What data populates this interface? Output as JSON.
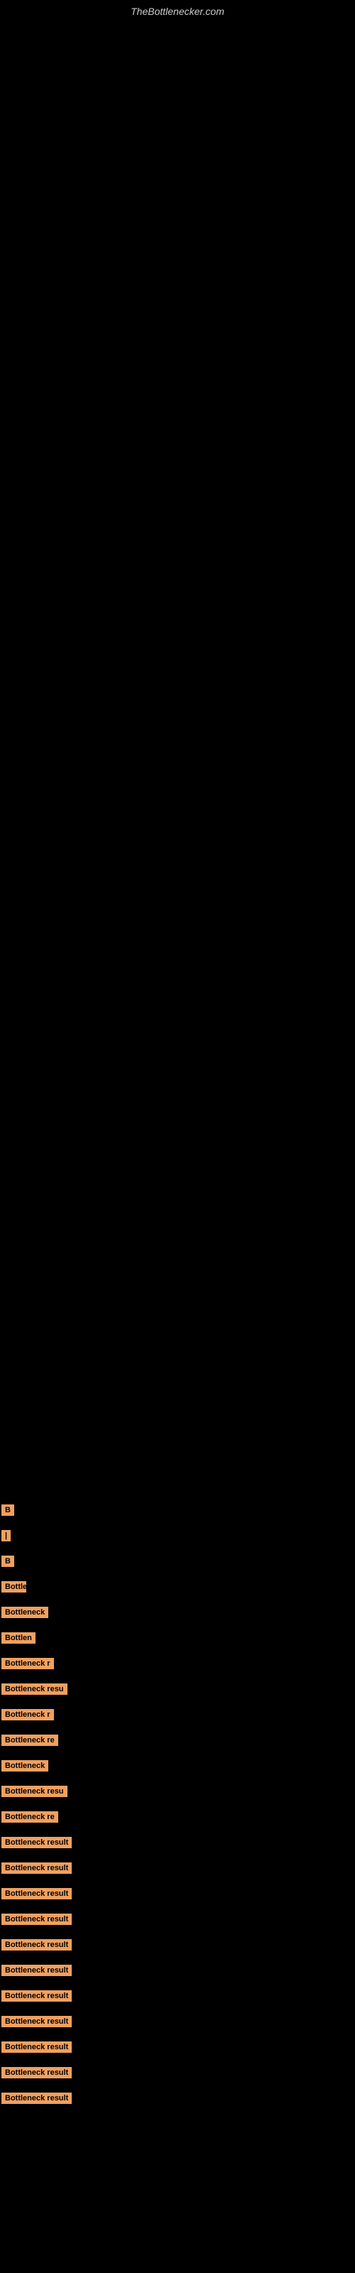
{
  "site": {
    "title": "TheBottlenecker.com"
  },
  "items": [
    {
      "id": 1,
      "label": "B",
      "width_class": "w-tiny"
    },
    {
      "id": 2,
      "label": "|",
      "width_class": "w-tiny"
    },
    {
      "id": 3,
      "label": "B",
      "width_class": "w-tiny"
    },
    {
      "id": 4,
      "label": "Bottle",
      "width_class": "w-small"
    },
    {
      "id": 5,
      "label": "Bottleneck",
      "width_class": "w-large"
    },
    {
      "id": 6,
      "label": "Bottlen",
      "width_class": "w-medium"
    },
    {
      "id": 7,
      "label": "Bottleneck r",
      "width_class": "w-xl"
    },
    {
      "id": 8,
      "label": "Bottleneck resu",
      "width_class": "w-xxl"
    },
    {
      "id": 9,
      "label": "Bottleneck r",
      "width_class": "w-xl"
    },
    {
      "id": 10,
      "label": "Bottleneck re",
      "width_class": "w-xxl"
    },
    {
      "id": 11,
      "label": "Bottleneck",
      "width_class": "w-large"
    },
    {
      "id": 12,
      "label": "Bottleneck resu",
      "width_class": "w-xxl"
    },
    {
      "id": 13,
      "label": "Bottleneck re",
      "width_class": "w-xxl"
    },
    {
      "id": 14,
      "label": "Bottleneck result",
      "width_class": "w-full"
    },
    {
      "id": 15,
      "label": "Bottleneck result",
      "width_class": "w-full"
    },
    {
      "id": 16,
      "label": "Bottleneck result",
      "width_class": "w-full"
    },
    {
      "id": 17,
      "label": "Bottleneck result",
      "width_class": "w-full"
    },
    {
      "id": 18,
      "label": "Bottleneck result",
      "width_class": "w-full"
    },
    {
      "id": 19,
      "label": "Bottleneck result",
      "width_class": "w-full"
    },
    {
      "id": 20,
      "label": "Bottleneck result",
      "width_class": "w-full"
    },
    {
      "id": 21,
      "label": "Bottleneck result",
      "width_class": "w-full"
    },
    {
      "id": 22,
      "label": "Bottleneck result",
      "width_class": "w-full"
    },
    {
      "id": 23,
      "label": "Bottleneck result",
      "width_class": "w-full"
    },
    {
      "id": 24,
      "label": "Bottleneck result",
      "width_class": "w-full"
    }
  ]
}
